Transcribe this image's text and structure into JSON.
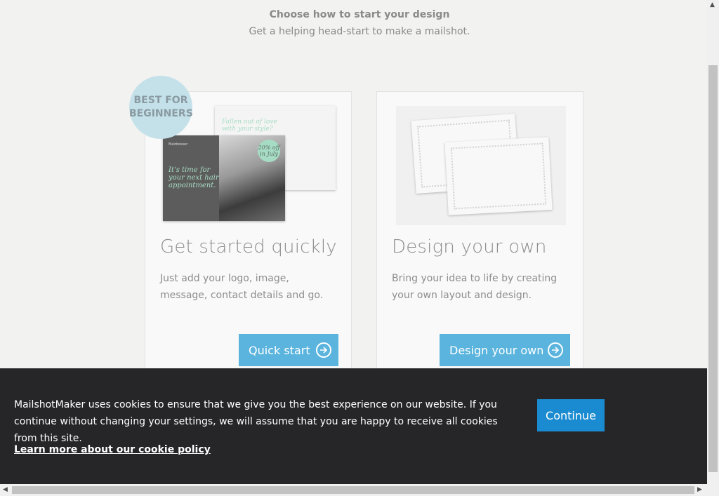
{
  "header": {
    "title": "Choose how to start your design",
    "subtitle": "Get a helping head-start to make a mailshot."
  },
  "cards": {
    "quick": {
      "badge_line1": "BEST FOR",
      "badge_line2": "BEGINNERS",
      "title": "Get started quickly",
      "description": "Just add your logo, image, message, contact details and go.",
      "button_label": "Quick start",
      "illustration": {
        "front_text": "It's time for your next hair appointment.",
        "front_brand": "Maidresser",
        "offer": "20% off in July",
        "back_text": "Fallen out of love with your style?"
      }
    },
    "own": {
      "title": "Design your own",
      "description": "Bring your idea to life by creating your own layout and design.",
      "button_label": "Design your own"
    }
  },
  "cookie_banner": {
    "message": "MailshotMaker uses cookies to ensure that we give you the best experience on our website. If you continue without changing your settings, we will assume that you are happy to receive all cookies from this site.",
    "link_label": "Learn more about our cookie policy",
    "button_label": "Continue"
  },
  "colors": {
    "accent_button": "#5ab4dd",
    "continue_button": "#1a8bd0",
    "badge": "#c4e1ea",
    "cookie_bg": "#262628"
  }
}
